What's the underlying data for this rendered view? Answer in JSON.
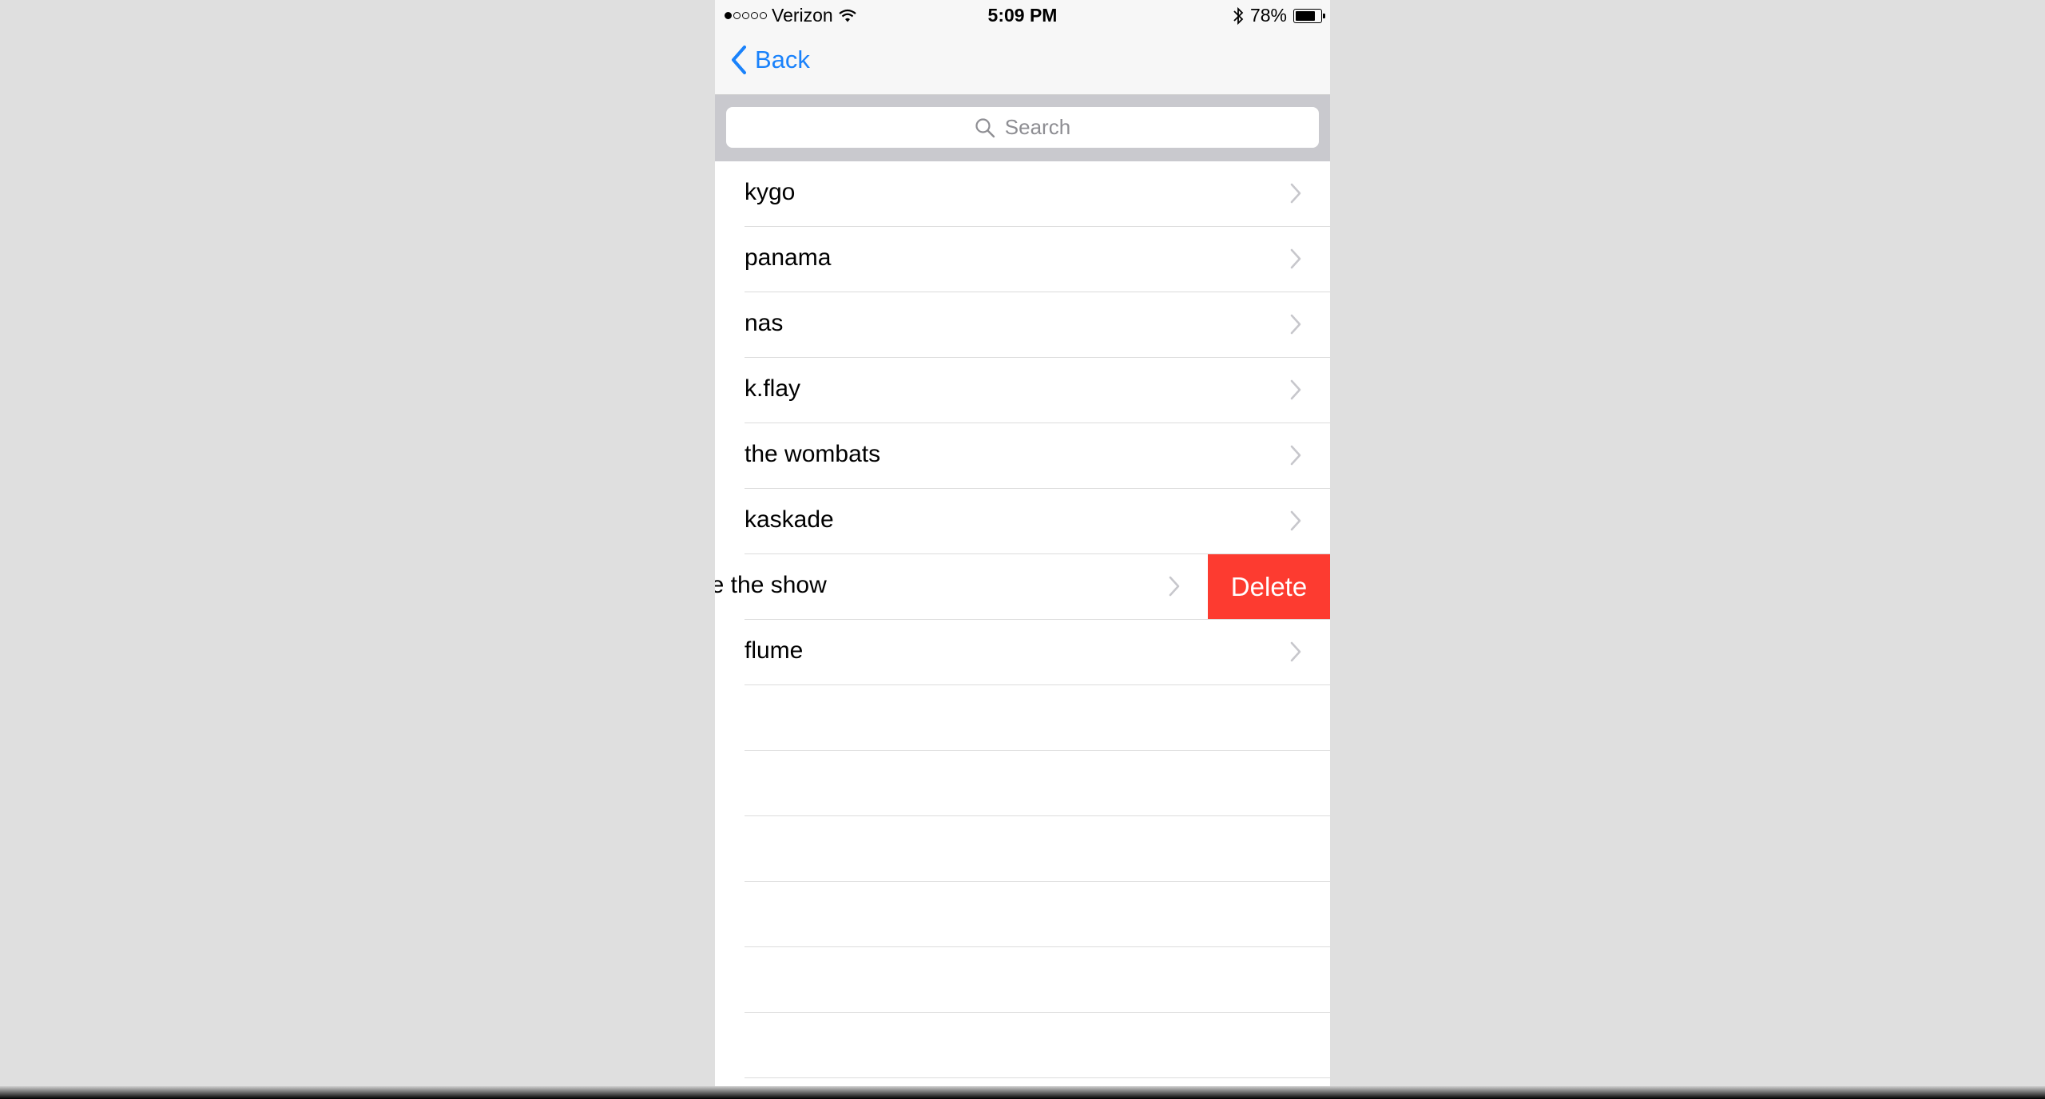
{
  "status_bar": {
    "carrier": "Verizon",
    "time": "5:09 PM",
    "battery_percent": "78%",
    "signal_dots_filled": 1,
    "signal_dots_total": 5
  },
  "nav": {
    "back_label": "Back",
    "back_color": "#1a82fb"
  },
  "search": {
    "placeholder": "Search",
    "icon": "search-icon"
  },
  "list": {
    "items": [
      {
        "label": "kygo"
      },
      {
        "label": "panama"
      },
      {
        "label": "nas"
      },
      {
        "label": "k.flay"
      },
      {
        "label": "the wombats"
      },
      {
        "label": "kaskade"
      },
      {
        "label": "le the show",
        "swiped": true
      },
      {
        "label": "flume"
      }
    ],
    "delete_label": "Delete",
    "delete_color": "#fd3b30",
    "empty_rows": 6
  }
}
